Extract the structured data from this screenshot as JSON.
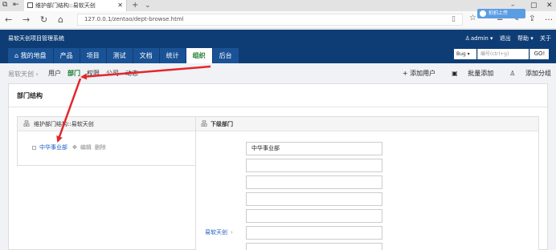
{
  "browser": {
    "tab_title": "维护部门结构::易软天创",
    "url": "127.0.0.1/zentao/dept-browse.html",
    "upload_label": "拍拍上传"
  },
  "header": {
    "brand": "易软天创项目管理系统",
    "user": "admin ▾",
    "logout": "退出",
    "help": "帮助 ▾",
    "about": "关于",
    "nav": [
      "我的地盘",
      "产品",
      "项目",
      "测试",
      "文档",
      "统计",
      "组织",
      "后台"
    ],
    "active_nav": "组织",
    "search": {
      "type": "Bug ▾",
      "placeholder": "编号(ctrl+g)",
      "button": "GO!"
    }
  },
  "subnav": {
    "breadcrumb": "易软天创 ›",
    "items": [
      "用户",
      "部门",
      "权限",
      "公司",
      "动态"
    ],
    "active": "部门",
    "actions": [
      "+ 添加用户",
      "批量添加",
      "添加分组"
    ]
  },
  "panel": {
    "title": "部门结构",
    "tree": {
      "header": "维护部门结构::易软天创",
      "item_name": "中华事业部",
      "edit": "编辑",
      "delete": "删除"
    },
    "child": {
      "header": "下级部门",
      "parent_label": "易软天创",
      "inputs": [
        "中华事业部",
        "",
        "",
        "",
        "",
        "",
        "",
        ""
      ]
    }
  },
  "colors": {
    "header_bg": "#0e3d76",
    "nav_bg": "#1a5296",
    "active_green": "#1a7a2c",
    "link_blue": "#1a5dbf",
    "annotation_red": "#e3262b"
  }
}
